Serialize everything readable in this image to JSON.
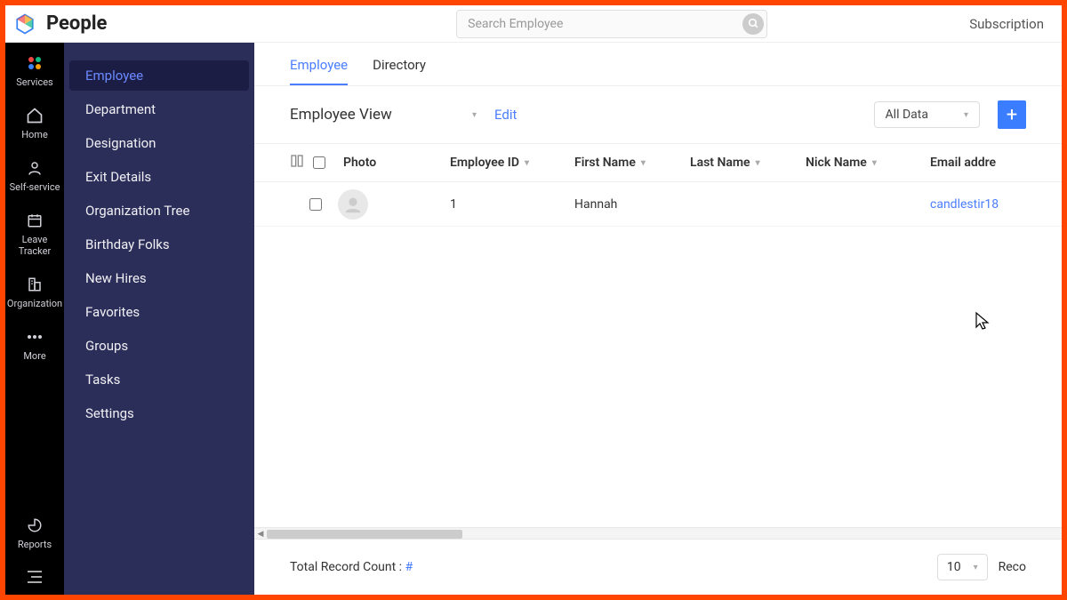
{
  "header": {
    "app_name": "People",
    "search_placeholder": "Search Employee",
    "subscription_label": "Subscription"
  },
  "rail": {
    "items": [
      {
        "key": "services",
        "label": "Services"
      },
      {
        "key": "home",
        "label": "Home"
      },
      {
        "key": "selfservice",
        "label": "Self-service"
      },
      {
        "key": "leave",
        "label": "Leave Tracker"
      },
      {
        "key": "organization",
        "label": "Organization"
      },
      {
        "key": "more",
        "label": "More"
      },
      {
        "key": "reports",
        "label": "Reports"
      }
    ]
  },
  "sidebar": {
    "items": [
      {
        "key": "employee",
        "label": "Employee",
        "active": true
      },
      {
        "key": "department",
        "label": "Department"
      },
      {
        "key": "designation",
        "label": "Designation"
      },
      {
        "key": "exit",
        "label": "Exit Details"
      },
      {
        "key": "orgtree",
        "label": "Organization Tree"
      },
      {
        "key": "birthday",
        "label": "Birthday Folks"
      },
      {
        "key": "newhires",
        "label": "New Hires"
      },
      {
        "key": "favorites",
        "label": "Favorites"
      },
      {
        "key": "groups",
        "label": "Groups"
      },
      {
        "key": "tasks",
        "label": "Tasks"
      },
      {
        "key": "settings",
        "label": "Settings"
      }
    ]
  },
  "tabs": [
    {
      "key": "employee",
      "label": "Employee",
      "active": true
    },
    {
      "key": "directory",
      "label": "Directory"
    }
  ],
  "toolbar": {
    "view_label": "Employee View",
    "edit_label": "Edit",
    "filter_label": "All Data",
    "add_label": "+"
  },
  "table": {
    "columns": {
      "photo": "Photo",
      "employee_id": "Employee ID",
      "first_name": "First Name",
      "last_name": "Last Name",
      "nick_name": "Nick Name",
      "email": "Email addre"
    },
    "rows": [
      {
        "employee_id": "1",
        "first_name": "Hannah",
        "last_name": "",
        "nick_name": "",
        "email": "candlestir18"
      }
    ]
  },
  "footer": {
    "count_label": "Total Record Count :",
    "count_value": "#",
    "page_size": "10",
    "records_label": "Reco"
  }
}
